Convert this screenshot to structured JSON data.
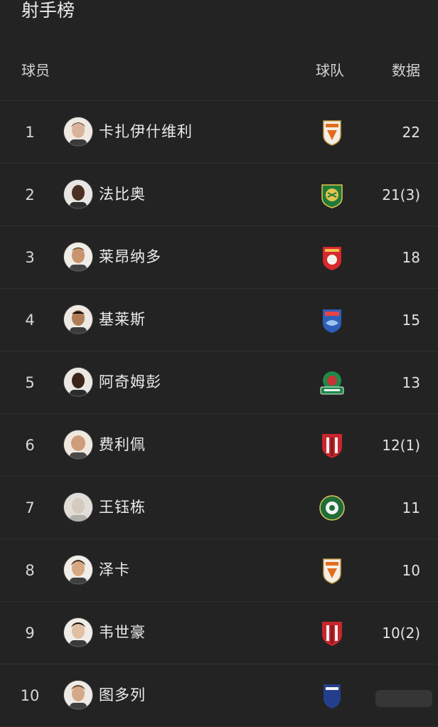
{
  "page_title": "射手榜",
  "header": {
    "player": "球员",
    "team": "球队",
    "stats": "数据"
  },
  "rows": [
    {
      "rank": "1",
      "name": "卡扎伊什维利",
      "team_badge": "shandong-taishan-badge",
      "stat": "22"
    },
    {
      "rank": "2",
      "name": "法比奥",
      "team_badge": "beijing-guoan-badge",
      "stat": "21(3)"
    },
    {
      "rank": "3",
      "name": "莱昂纳多",
      "team_badge": "shanghai-port-badge",
      "stat": "18"
    },
    {
      "rank": "4",
      "name": "基莱斯",
      "team_badge": "qingdao-hainiu-badge",
      "stat": "15"
    },
    {
      "rank": "5",
      "name": "阿奇姆彭",
      "team_badge": "henan-badge",
      "stat": "13"
    },
    {
      "rank": "6",
      "name": "费利佩",
      "team_badge": "chengdu-rongcheng-badge",
      "stat": "12(1)"
    },
    {
      "rank": "7",
      "name": "王钰栋",
      "team_badge": "zhejiang-badge",
      "stat": "11"
    },
    {
      "rank": "8",
      "name": "泽卡",
      "team_badge": "shandong-taishan-badge",
      "stat": "10"
    },
    {
      "rank": "9",
      "name": "韦世豪",
      "team_badge": "chengdu-rongcheng-badge",
      "stat": "10(2)"
    },
    {
      "rank": "10",
      "name": "图多列",
      "team_badge": "shanghai-shenhua-badge",
      "stat": ""
    }
  ],
  "colors": {
    "background": "#232323",
    "divider": "#303030",
    "text": "#ececec"
  }
}
